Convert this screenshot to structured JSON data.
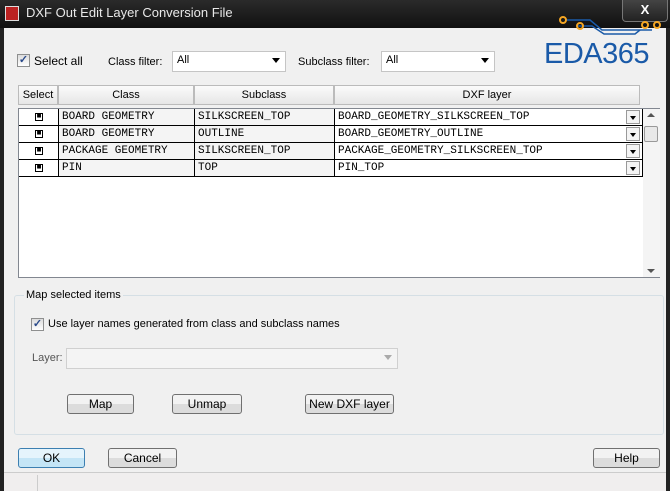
{
  "window": {
    "title": "DXF Out Edit Layer Conversion File",
    "close_label": "X"
  },
  "logo": {
    "text": "EDA365",
    "color": "#1a5aa8",
    "accent": "#f5a623"
  },
  "filters": {
    "select_all_label": "Select all",
    "select_all_checked": true,
    "class_filter_label": "Class filter:",
    "class_filter_value": "All",
    "subclass_filter_label": "Subclass filter:",
    "subclass_filter_value": "All"
  },
  "table": {
    "columns": [
      "Select",
      "Class",
      "Subclass",
      "DXF layer"
    ],
    "rows": [
      {
        "selected": true,
        "class": "BOARD GEOMETRY",
        "subclass": "SILKSCREEN_TOP",
        "dxf_layer": "BOARD_GEOMETRY_SILKSCREEN_TOP"
      },
      {
        "selected": true,
        "class": "BOARD GEOMETRY",
        "subclass": "OUTLINE",
        "dxf_layer": "BOARD_GEOMETRY_OUTLINE"
      },
      {
        "selected": true,
        "class": "PACKAGE GEOMETRY",
        "subclass": "SILKSCREEN_TOP",
        "dxf_layer": "PACKAGE_GEOMETRY_SILKSCREEN_TOP"
      },
      {
        "selected": true,
        "class": "PIN",
        "subclass": "TOP",
        "dxf_layer": "PIN_TOP"
      }
    ]
  },
  "map_group": {
    "title": "Map selected items",
    "use_names_label": "Use layer names generated from class and subclass names",
    "use_names_checked": true,
    "layer_label": "Layer:",
    "layer_value": "",
    "map_label": "Map",
    "unmap_label": "Unmap",
    "new_layer_label": "New DXF layer"
  },
  "footer": {
    "ok_label": "OK",
    "cancel_label": "Cancel",
    "help_label": "Help"
  }
}
